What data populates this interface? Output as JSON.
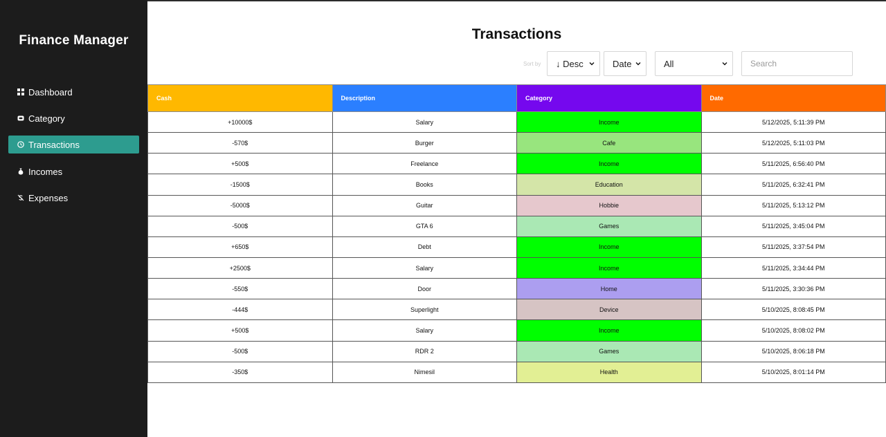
{
  "app": {
    "brand": "Finance Manager"
  },
  "sidebar": {
    "items": [
      {
        "label": "Dashboard",
        "icon": "grid-icon",
        "active": false
      },
      {
        "label": "Category",
        "icon": "tag-icon",
        "active": false
      },
      {
        "label": "Transactions",
        "icon": "clock-icon",
        "active": true
      },
      {
        "label": "Incomes",
        "icon": "money-bag-icon",
        "active": false
      },
      {
        "label": "Expenses",
        "icon": "dollar-slash-icon",
        "active": false
      }
    ]
  },
  "page": {
    "title": "Transactions"
  },
  "controls": {
    "sort_label": "Sort by",
    "sort_direction": "↓ Desc",
    "sort_field": "Date",
    "category_filter": "All",
    "search_placeholder": "Search",
    "search_value": ""
  },
  "table": {
    "headers": [
      {
        "label": "Cash",
        "color": "#ffb800"
      },
      {
        "label": "Description",
        "color": "#2b7fff"
      },
      {
        "label": "Category",
        "color": "#7508ee"
      },
      {
        "label": "Date",
        "color": "#ff6a00"
      }
    ],
    "rows": [
      {
        "cash": "+10000$",
        "type": "income",
        "description": "Salary",
        "category": "Income",
        "category_color": "#00ff00",
        "date": "5/12/2025, 5:11:39 PM"
      },
      {
        "cash": "-570$",
        "type": "expense",
        "description": "Burger",
        "category": "Cafe",
        "category_color": "#98e57e",
        "date": "5/12/2025, 5:11:03 PM"
      },
      {
        "cash": "+500$",
        "type": "income",
        "description": "Freelance",
        "category": "Income",
        "category_color": "#00ff00",
        "date": "5/11/2025, 6:56:40 PM"
      },
      {
        "cash": "-1500$",
        "type": "expense",
        "description": "Books",
        "category": "Education",
        "category_color": "#d4e5a8",
        "date": "5/11/2025, 6:32:41 PM"
      },
      {
        "cash": "-5000$",
        "type": "expense",
        "description": "Guitar",
        "category": "Hobbie",
        "category_color": "#e6c8cd",
        "date": "5/11/2025, 5:13:12 PM"
      },
      {
        "cash": "-500$",
        "type": "expense",
        "description": "GTA 6",
        "category": "Games",
        "category_color": "#aae8b4",
        "date": "5/11/2025, 3:45:04 PM"
      },
      {
        "cash": "+650$",
        "type": "income",
        "description": "Debt",
        "category": "Income",
        "category_color": "#00ff00",
        "date": "5/11/2025, 3:37:54 PM"
      },
      {
        "cash": "+2500$",
        "type": "income",
        "description": "Salary",
        "category": "Income",
        "category_color": "#00ff00",
        "date": "5/11/2025, 3:34:44 PM"
      },
      {
        "cash": "-550$",
        "type": "expense",
        "description": "Door",
        "category": "Home",
        "category_color": "#ac9ef0",
        "date": "5/11/2025, 3:30:36 PM"
      },
      {
        "cash": "-444$",
        "type": "expense",
        "description": "Superlight",
        "category": "Device",
        "category_color": "#d6c4c4",
        "date": "5/10/2025, 8:08:45 PM"
      },
      {
        "cash": "+500$",
        "type": "income",
        "description": "Salary",
        "category": "Income",
        "category_color": "#00ff00",
        "date": "5/10/2025, 8:08:02 PM"
      },
      {
        "cash": "-500$",
        "type": "expense",
        "description": "RDR 2",
        "category": "Games",
        "category_color": "#aae8b4",
        "date": "5/10/2025, 8:06:18 PM"
      },
      {
        "cash": "-350$",
        "type": "expense",
        "description": "Nimesil",
        "category": "Health",
        "category_color": "#e2ef94",
        "date": "5/10/2025, 8:01:14 PM"
      }
    ]
  },
  "colors": {
    "sidebar_bg": "#1c1c1c",
    "active_nav": "#2d9c8f",
    "income_text": "#1e8c1e",
    "expense_text": "#e02020"
  }
}
